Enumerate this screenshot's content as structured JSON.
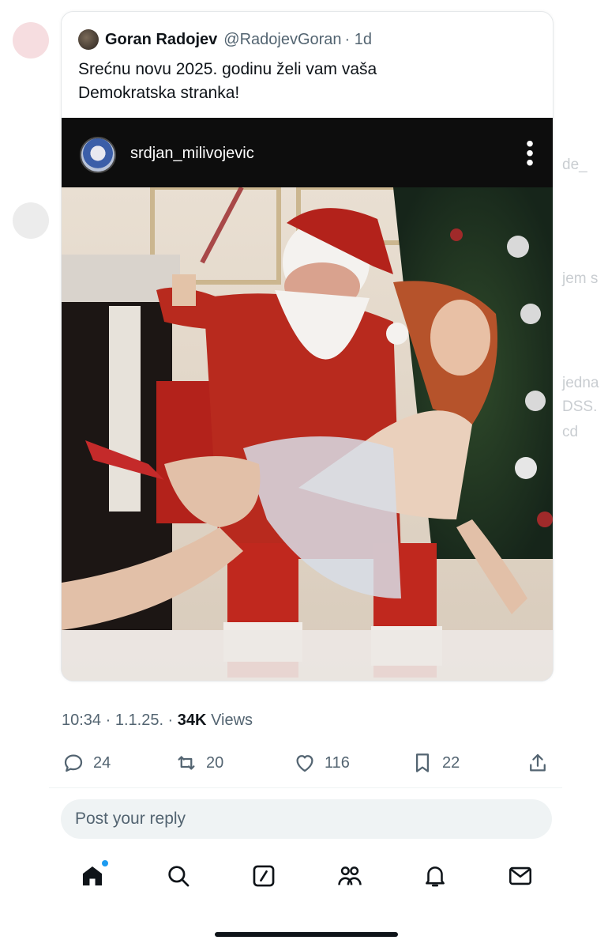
{
  "background": {
    "fragments": [
      "de_",
      "jem s",
      "jedna",
      "DSS.",
      "cd"
    ]
  },
  "quoted_tweet": {
    "author_name": "Goran Radojev",
    "author_handle": "@RadojevGoran",
    "time_ago": "· 1d",
    "text_line1": "Srećnu novu 2025. godinu želi vam vaša",
    "text_line2": "Demokratska stranka!",
    "embed": {
      "username": "srdjan_milivojevic",
      "more_icon": "vertical-dots-icon"
    }
  },
  "tweet_meta": {
    "time": "10:34",
    "date": "· 1.1.25. ·",
    "views_count": "34K",
    "views_label": "Views"
  },
  "actions": {
    "replies": "24",
    "retweets": "20",
    "likes": "116",
    "bookmarks": "22"
  },
  "reply": {
    "placeholder": "Post your reply"
  },
  "nav": {
    "items": [
      "home-icon",
      "search-icon",
      "compose-icon",
      "communities-icon",
      "notifications-icon",
      "messages-icon"
    ]
  },
  "colors": {
    "text_primary": "#0f1419",
    "text_secondary": "#536471",
    "accent": "#1d9bf0",
    "embed_bar": "#0d0d0d"
  }
}
